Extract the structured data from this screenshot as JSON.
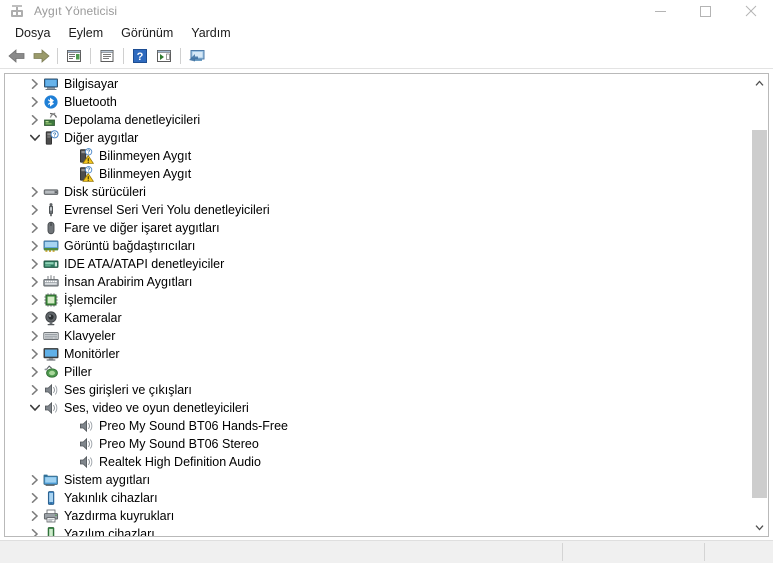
{
  "window": {
    "title": "Aygıt Yöneticisi",
    "app_icon": "device-manager-icon",
    "caption": {
      "minimize": "minimize-icon",
      "maximize": "maximize-icon",
      "close": "close-icon"
    }
  },
  "menubar": {
    "items": [
      {
        "label": "Dosya"
      },
      {
        "label": "Eylem"
      },
      {
        "label": "Görünüm"
      },
      {
        "label": "Yardım"
      }
    ]
  },
  "toolbar": {
    "buttons": [
      {
        "name": "back-button",
        "icon": "back-arrow-icon"
      },
      {
        "name": "forward-button",
        "icon": "forward-arrow-icon"
      },
      {
        "name": "separator-1",
        "icon": "separator"
      },
      {
        "name": "properties-button",
        "icon": "properties-icon"
      },
      {
        "name": "separator-2",
        "icon": "separator"
      },
      {
        "name": "show-hide-console-tree-button",
        "icon": "console-tree-icon"
      },
      {
        "name": "separator-3",
        "icon": "separator"
      },
      {
        "name": "help-button",
        "icon": "help-question-icon"
      },
      {
        "name": "scan-hardware-changes-button",
        "icon": "scan-hardware-icon"
      },
      {
        "name": "separator-4",
        "icon": "separator"
      },
      {
        "name": "update-driver-button",
        "icon": "update-driver-icon"
      }
    ]
  },
  "tree": {
    "nodes": [
      {
        "label": "Bilgisayar",
        "level": 0,
        "state": "collapsed",
        "icon": "computer-icon"
      },
      {
        "label": "Bluetooth",
        "level": 0,
        "state": "collapsed",
        "icon": "bluetooth-icon"
      },
      {
        "label": "Depolama denetleyicileri",
        "level": 0,
        "state": "collapsed",
        "icon": "storage-controller-icon"
      },
      {
        "label": "Diğer aygıtlar",
        "level": 0,
        "state": "expanded",
        "icon": "other-devices-icon"
      },
      {
        "label": "Bilinmeyen Aygıt",
        "level": 1,
        "state": "leaf",
        "icon": "unknown-device-warning-icon"
      },
      {
        "label": "Bilinmeyen Aygıt",
        "level": 1,
        "state": "leaf",
        "icon": "unknown-device-warning-icon"
      },
      {
        "label": "Disk sürücüleri",
        "level": 0,
        "state": "collapsed",
        "icon": "disk-drive-icon"
      },
      {
        "label": "Evrensel Seri Veri Yolu denetleyicileri",
        "level": 0,
        "state": "collapsed",
        "icon": "usb-controller-icon"
      },
      {
        "label": "Fare ve diğer işaret aygıtları",
        "level": 0,
        "state": "collapsed",
        "icon": "mouse-icon"
      },
      {
        "label": "Görüntü bağdaştırıcıları",
        "level": 0,
        "state": "collapsed",
        "icon": "display-adapter-icon"
      },
      {
        "label": "IDE ATA/ATAPI denetleyiciler",
        "level": 0,
        "state": "collapsed",
        "icon": "ide-controller-icon"
      },
      {
        "label": "İnsan Arabirim Aygıtları",
        "level": 0,
        "state": "collapsed",
        "icon": "hid-icon"
      },
      {
        "label": "İşlemciler",
        "level": 0,
        "state": "collapsed",
        "icon": "processor-icon"
      },
      {
        "label": "Kameralar",
        "level": 0,
        "state": "collapsed",
        "icon": "camera-icon"
      },
      {
        "label": "Klavyeler",
        "level": 0,
        "state": "collapsed",
        "icon": "keyboard-icon"
      },
      {
        "label": "Monitörler",
        "level": 0,
        "state": "collapsed",
        "icon": "monitor-icon"
      },
      {
        "label": "Piller",
        "level": 0,
        "state": "collapsed",
        "icon": "battery-icon"
      },
      {
        "label": "Ses girişleri ve çıkışları",
        "level": 0,
        "state": "collapsed",
        "icon": "speaker-icon"
      },
      {
        "label": "Ses, video ve oyun denetleyicileri",
        "level": 0,
        "state": "expanded",
        "icon": "speaker-icon"
      },
      {
        "label": "Preo My Sound BT06 Hands-Free",
        "level": 1,
        "state": "leaf",
        "icon": "speaker-icon"
      },
      {
        "label": "Preo My Sound BT06 Stereo",
        "level": 1,
        "state": "leaf",
        "icon": "speaker-icon"
      },
      {
        "label": "Realtek High Definition Audio",
        "level": 1,
        "state": "leaf",
        "icon": "speaker-icon"
      },
      {
        "label": "Sistem aygıtları",
        "level": 0,
        "state": "collapsed",
        "icon": "system-devices-icon"
      },
      {
        "label": "Yakınlık cihazları",
        "level": 0,
        "state": "collapsed",
        "icon": "proximity-device-icon"
      },
      {
        "label": "Yazdırma kuyrukları",
        "level": 0,
        "state": "collapsed",
        "icon": "print-queue-icon"
      },
      {
        "label": "Yazılım cihazları",
        "level": 0,
        "state": "collapsed",
        "icon": "software-device-icon"
      }
    ]
  },
  "scrollbar": {
    "up_arrow": "scroll-up-icon",
    "down_arrow": "scroll-down-icon",
    "thumb_top_pct": 9,
    "thumb_height_pct": 86
  },
  "statusbar": {
    "panels": [
      "",
      "",
      ""
    ]
  },
  "colors": {
    "accent_blue": "#2f7fd1",
    "warning_yellow": "#f0c419",
    "green": "#4f9b4f",
    "titlebar_text": "#9a9a9a",
    "scroll_thumb": "#cdcdcd"
  }
}
